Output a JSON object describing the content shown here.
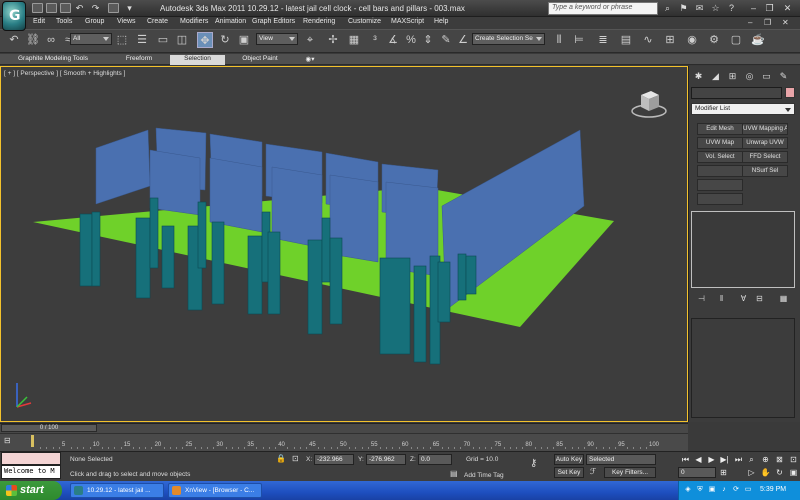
{
  "window": {
    "title": "Autodesk 3ds Max  2011      10.29.12 - latest jail cell clock - cell bars and pillars - 003.max",
    "search_placeholder": "Type a keyword or phrase"
  },
  "menu": [
    "Edit",
    "Tools",
    "Group",
    "Views",
    "Create",
    "Modifiers",
    "Animation",
    "Graph Editors",
    "Rendering",
    "Customize",
    "MAXScript",
    "Help"
  ],
  "toolbar": {
    "selection_filter": "All",
    "ref_coord": "View",
    "named_selection": "Create Selection Se"
  },
  "ribbon_tabs": [
    "Graphite Modeling Tools",
    "Freeform",
    "Selection",
    "Object Paint"
  ],
  "viewport": {
    "label": "[ + ] [ Perspective ] [ Smooth + Highlights ]",
    "colors": {
      "ground": "#6fd12a",
      "walls": "#4a70b0",
      "pillars": "#16707a"
    }
  },
  "command_panel": {
    "modifier_list": "Modifier List",
    "buttons": [
      "Edit Mesh",
      "UVW Mapping Ad",
      "UVW Map",
      "Unwrap UVW",
      "Vol. Select",
      "FFD Select",
      "",
      "NSurf Sel",
      "",
      ""
    ]
  },
  "timeline": {
    "frame": "0 / 100",
    "ticks": [
      0,
      5,
      10,
      15,
      20,
      25,
      30,
      35,
      40,
      45,
      50,
      55,
      60,
      65,
      70,
      75,
      80,
      85,
      90,
      95,
      100
    ]
  },
  "status": {
    "listener_text": "Welcome to M",
    "selection": "None Selected",
    "prompt": "Click and drag to select and move objects",
    "x_label": "X:",
    "x_value": "-232.966",
    "y_label": "Y:",
    "y_value": "-276.962",
    "z_label": "Z:",
    "z_value": "0.0",
    "grid": "Grid = 10.0",
    "add_time_tag": "Add Time Tag",
    "auto_key": "Auto Key",
    "set_key": "Set Key",
    "key_mode": "Selected",
    "key_filters": "Key Filters...",
    "current_frame": "0"
  },
  "taskbar": {
    "start": "start",
    "tasks": [
      "10.29.12 - latest jail ...",
      "XnView - [Browser - C..."
    ],
    "clock": "5:39 PM"
  }
}
